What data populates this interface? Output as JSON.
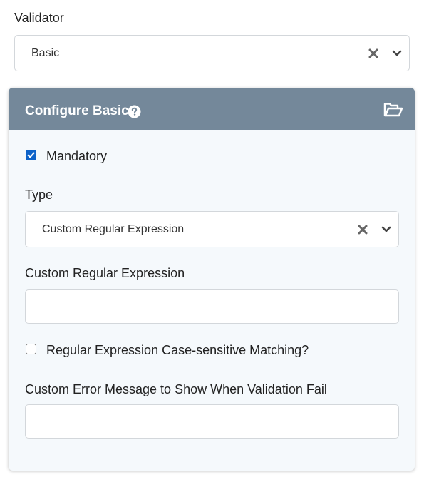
{
  "validator": {
    "label": "Validator",
    "selected_value": "Basic"
  },
  "panel": {
    "title": "Configure Basic",
    "mandatory": {
      "label": "Mandatory",
      "checked": true
    },
    "type": {
      "label": "Type",
      "selected_value": "Custom Regular Expression"
    },
    "custom_regex": {
      "label": "Custom Regular Expression",
      "value": ""
    },
    "case_sensitive": {
      "label": "Regular Expression Case-sensitive Matching?",
      "checked": false
    },
    "error_message": {
      "label": "Custom Error Message to Show When Validation Fail",
      "value": ""
    }
  },
  "icons": {
    "help": "question-circle-icon",
    "folder": "folder-open-icon",
    "clear": "clear-x-icon",
    "dropdown": "chevron-down-icon"
  },
  "colors": {
    "header_bg": "#74889a",
    "panel_bg": "#f5f9fc",
    "checkbox_accent": "#0d62c8"
  }
}
